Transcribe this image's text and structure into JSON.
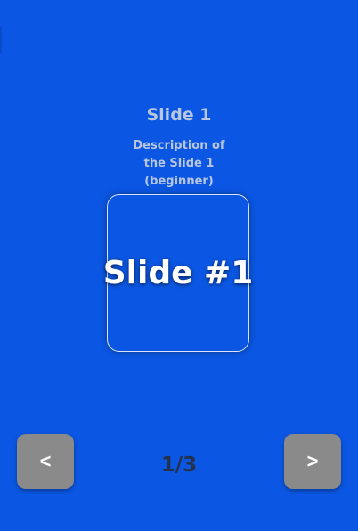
{
  "slide": {
    "title": "Slide 1",
    "description": "Description of\nthe  Slide 1\n(beginner)",
    "card_text": "Slide #1"
  },
  "navigation": {
    "prev_label": "<",
    "next_label": ">",
    "counter": "1/3"
  },
  "colors": {
    "background": "#0b57e3",
    "button": "#8a8a8a",
    "title_text": "#b8c6df",
    "counter_text": "#23324a"
  }
}
